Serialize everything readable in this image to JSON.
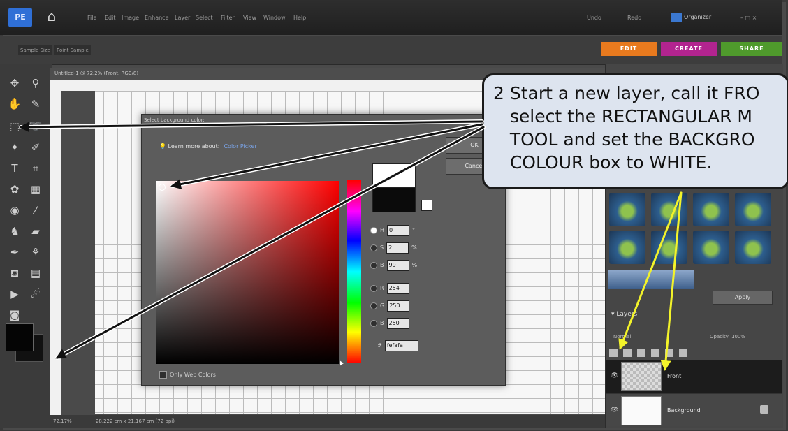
{
  "app": {
    "logo_text": "PE",
    "menu": [
      "File",
      "Edit",
      "Image",
      "Enhance",
      "Layer",
      "Select",
      "Filter",
      "View",
      "Window",
      "Help"
    ],
    "right_controls": [
      "Undo",
      "Redo"
    ],
    "organizer_label": "Organizer",
    "window_controls": "– □ ×"
  },
  "options": {
    "labels": [
      "Sample Size",
      "Point Sample"
    ]
  },
  "mode_tabs": [
    {
      "label": "EDIT",
      "color": "#e87a1e"
    },
    {
      "label": "CREATE",
      "color": "#b2248f"
    },
    {
      "label": "SHARE",
      "color": "#4f9a2c"
    }
  ],
  "document": {
    "tab_title": "Untitled-1 @ 72.2% (Front, RGB/8)",
    "zoom": "72.17%",
    "status": "28.222 cm x 21.167 cm (72 ppi)"
  },
  "dialog": {
    "title": "Select background color:",
    "learn_text": "Learn more about:",
    "learn_link": "Color Picker",
    "ok_label": "OK",
    "cancel_label": "Cancel",
    "fields": [
      {
        "label": "H",
        "value": "0",
        "unit": "°",
        "selected": true
      },
      {
        "label": "S",
        "value": "2",
        "unit": "%",
        "selected": false
      },
      {
        "label": "B",
        "value": "99",
        "unit": "%",
        "selected": false
      },
      {
        "label": "R",
        "value": "254",
        "unit": "",
        "selected": false
      },
      {
        "label": "G",
        "value": "250",
        "unit": "",
        "selected": false
      },
      {
        "label": "B",
        "value": "250",
        "unit": "",
        "selected": false
      }
    ],
    "hex_label": "#",
    "hex_value": "fefafa",
    "web_only_label": "Only Web Colors",
    "new_color": "#ffffff",
    "current_color": "#0b0b0b"
  },
  "panel": {
    "apply_label": "Apply",
    "layers_title": "Layers",
    "blend_mode": "Normal",
    "opacity_label": "Opacity:",
    "opacity_value": "100%",
    "layers": [
      {
        "name": "Front",
        "selected": true
      },
      {
        "name": "Background",
        "selected": false
      }
    ]
  },
  "callout": {
    "text": "2 Start a new layer, call it FRO\n   select the RECTANGULAR M\n   TOOL and set the BACKGRO\n   COLOUR box to WHITE."
  },
  "colors": {
    "arrow_black": "#111111",
    "arrow_yellow": "#f3f32a",
    "callout_fill": "#dde4ef"
  }
}
